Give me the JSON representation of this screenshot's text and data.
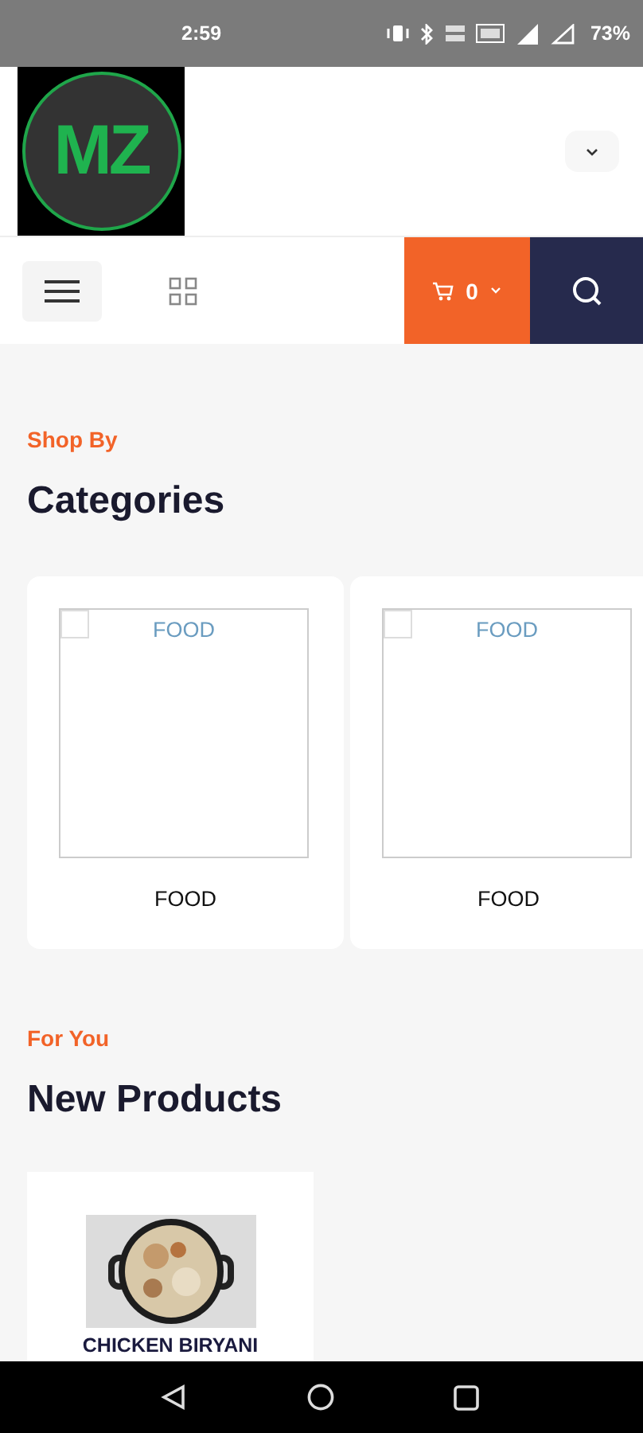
{
  "status_bar": {
    "time": "2:59",
    "battery": "73%"
  },
  "header": {
    "logo_text": "MZ"
  },
  "toolbar": {
    "cart_count": "0"
  },
  "sections": [
    {
      "kind": "categories",
      "kicker": "Shop By",
      "title": "Categories",
      "items": [
        {
          "image_alt": "FOOD",
          "name": "FOOD"
        },
        {
          "image_alt": "FOOD",
          "name": "FOOD"
        }
      ]
    },
    {
      "kind": "products",
      "kicker": "For You",
      "title": "New Products",
      "items": [
        {
          "name": "CHICKEN BIRYANI"
        }
      ]
    }
  ]
}
